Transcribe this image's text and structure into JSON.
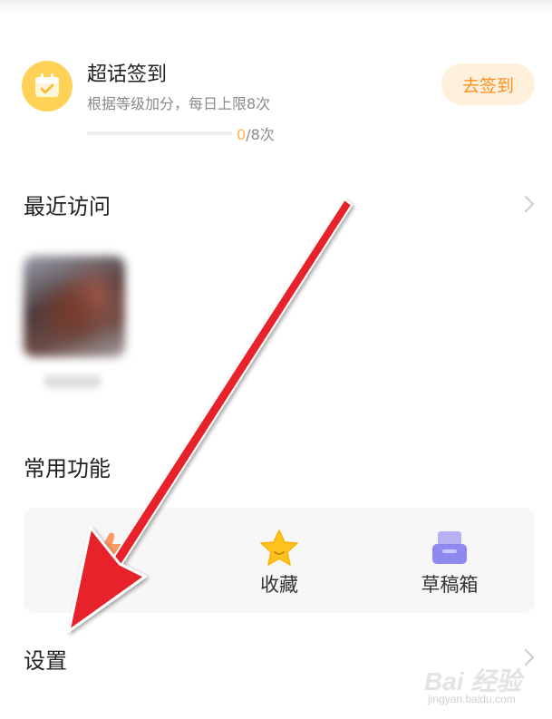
{
  "checkin": {
    "title": "超话签到",
    "subtitle": "根据等级加分，每日上限8次",
    "progress_current": "0",
    "progress_total": "/8次",
    "progress_fraction": 0,
    "button_label": "去签到",
    "icon": "calendar-check-icon"
  },
  "recent": {
    "title": "最近访问",
    "chevron_icon": "chevron-right-icon"
  },
  "common": {
    "title": "常用功能",
    "features": [
      {
        "label": "",
        "icon": "thumb-up-icon"
      },
      {
        "label": "收藏",
        "icon": "star-icon"
      },
      {
        "label": "草稿箱",
        "icon": "draft-box-icon"
      }
    ]
  },
  "settings": {
    "title": "设置",
    "chevron_icon": "chevron-right-icon"
  },
  "watermark": {
    "text": "Bai 经验",
    "sub": "jingyan.baidu.com"
  },
  "colors": {
    "accent": "#ffb347",
    "button_bg": "#fff0dc",
    "button_text": "#ff8f1f",
    "checkin_icon_bg": "#ffd257",
    "arrow": "#e8202a"
  }
}
